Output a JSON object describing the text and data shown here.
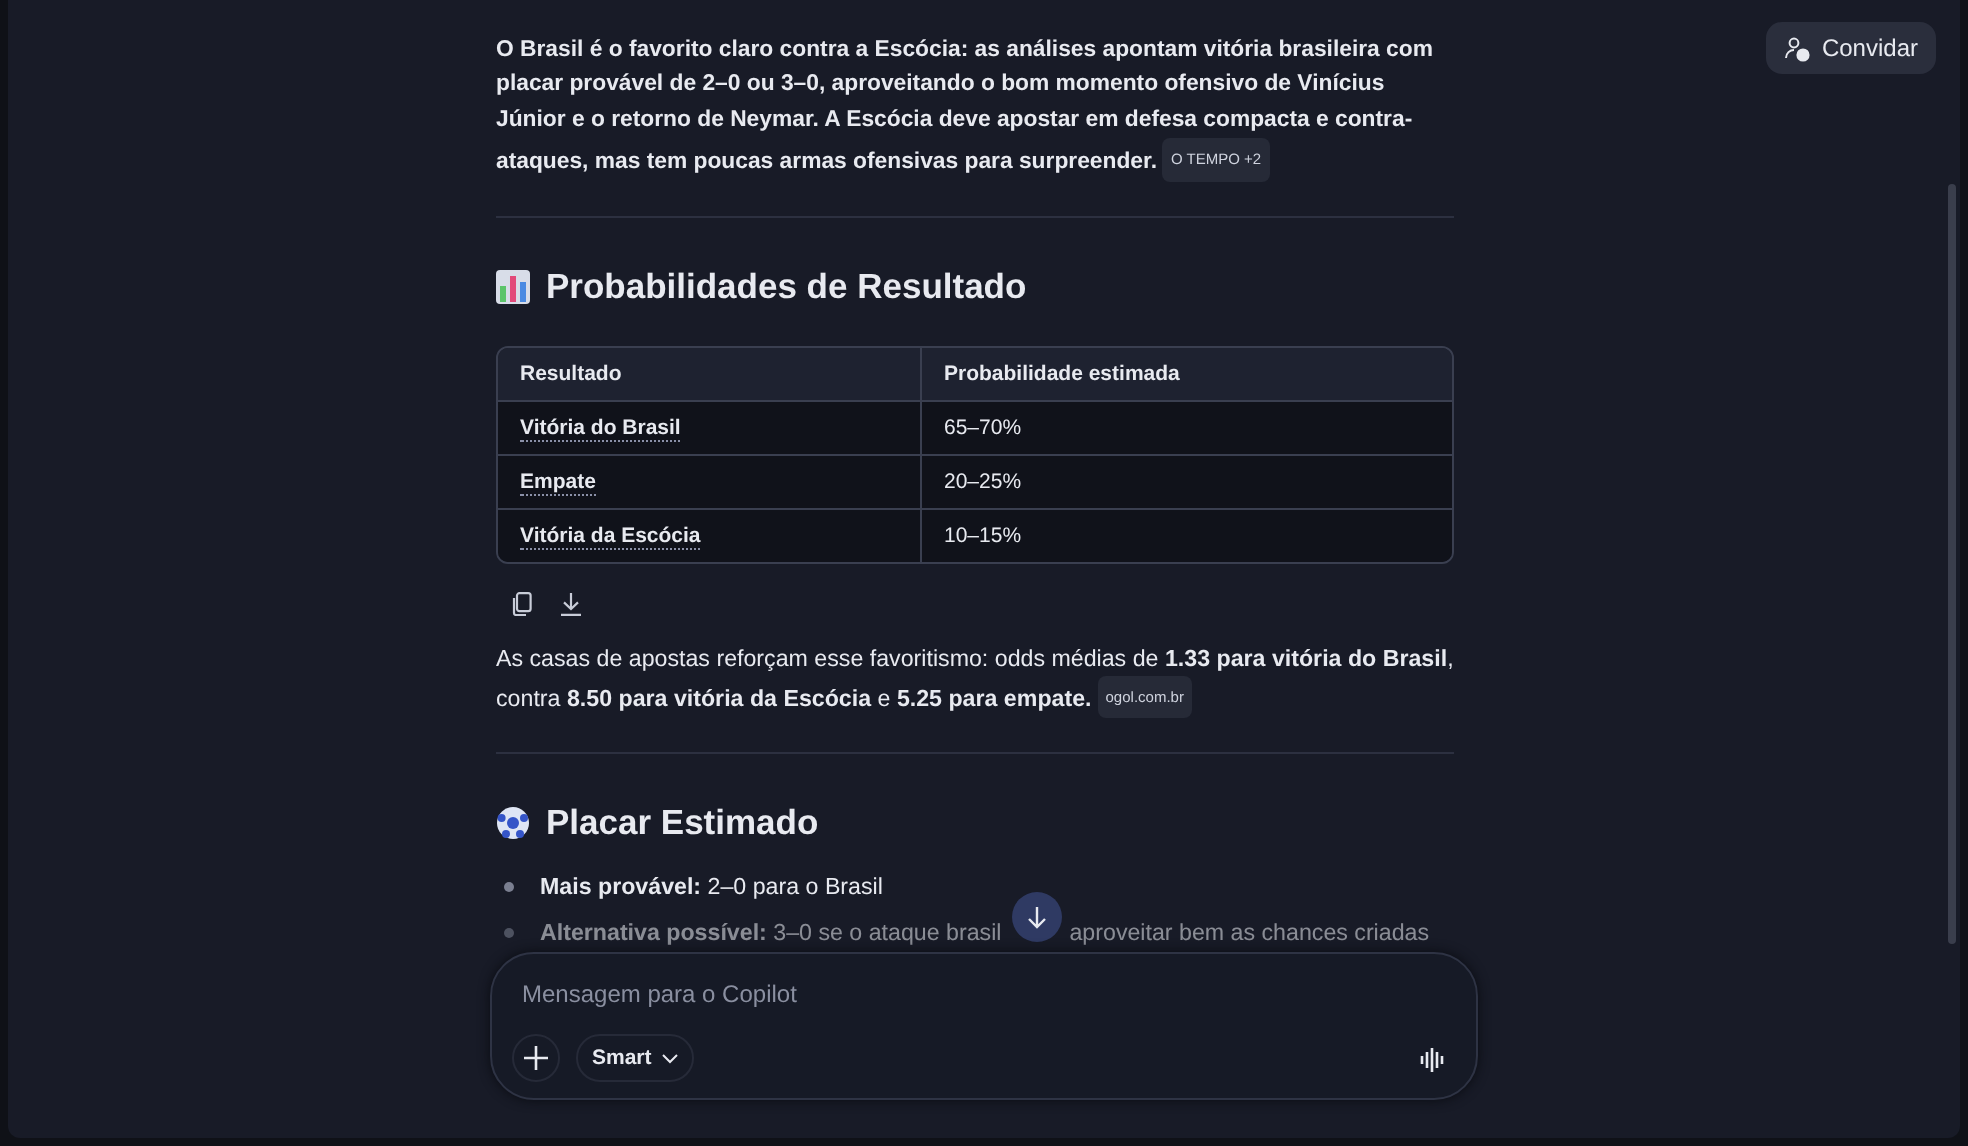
{
  "header": {
    "invite_button": "Convidar"
  },
  "intro": {
    "text": "O Brasil é o favorito claro contra a Escócia: as análises apontam vitória brasileira com placar provável de 2–0 ou 3–0, aproveitando o bom momento ofensivo de Vinícius Júnior e o retorno de Neymar. A Escócia deve apostar em defesa compacta e contra-ataques, mas tem poucas armas ofensivas para surpreender.",
    "citation": {
      "source": "O TEMPO",
      "more": "+2"
    }
  },
  "section_1": {
    "title": "Probabilidades de Resultado",
    "table": {
      "columns": [
        "Resultado",
        "Probabilidade estimada"
      ],
      "rows": [
        [
          "Vitória do Brasil",
          "65–70%"
        ],
        [
          "Empate",
          "20–25%"
        ],
        [
          "Vitória da Escócia",
          "10–15%"
        ]
      ]
    },
    "after": {
      "text": "As casas de apostas reforçam esse favoritismo: odds médias de **1.33 para vitória do Brasil**, contra **8.50 para vitória da Escócia** e **5.25 para empate.**",
      "citation": {
        "source": "ogol.com.br"
      }
    }
  },
  "section_2": {
    "title": "Placar Estimado",
    "items": [
      {
        "label": "Mais provável:",
        "text": "2–0 para o Brasil",
        "faded": false
      },
      {
        "label": "Alternativa possível:",
        "text": "3–0 se o ataque brasil",
        "text_after": "aproveitar bem as chances criadas",
        "faded": true
      }
    ]
  },
  "composer": {
    "placeholder": "Mensagem para o Copilot",
    "mode": "Smart"
  }
}
